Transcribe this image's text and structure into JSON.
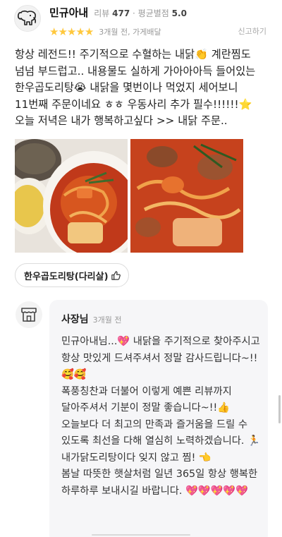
{
  "reviewer": {
    "nickname": "민규아내",
    "review_count_label": "리뷰",
    "review_count": "477",
    "avg_rating_label": "평균별점",
    "avg_rating": "5.0",
    "avatar_icon": "elephant-icon"
  },
  "rating": {
    "stars": 5,
    "star_glyph": "★",
    "star_color": "#ffc83d"
  },
  "meta": "3개월 전, 가게배달",
  "report_label": "신고하기",
  "review": {
    "text": "항상 레전드!! 주기적으로 수혈하는 내닭👏 계란찜도 넘넘 부드럽고.. 내용물도 실하게 가아아아득 들어있는 한우곱도리탕😭 내닭을 몇번이나 먹었지 세어보니 11번째 주문이네요 ㅎㅎ 우동사리 추가 필수!!!!!!⭐ 오늘 저녁은 내가 행복하고싶다 >> 내닭 주문.."
  },
  "photos": [
    {
      "icon": "food-photo-icon"
    },
    {
      "icon": "food-photo-icon"
    }
  ],
  "menu_chip": {
    "label": "한우곱도리탕(다리살)",
    "icon": "thumbs-up-icon"
  },
  "owner_reply": {
    "name": "사장님",
    "date": "3개월 전",
    "icon": "store-icon",
    "text": "민규아내님...💖 내닭을 주기적으로 찾아주시고 항상 맛있게 드셔주셔서 정말 감사드립니다~!!🥰🥰\n폭풍칭찬과 더불어 이렇게 예쁜 리뷰까지 달아주셔서 기분이 정말 좋습니다~!!👍\n오늘보다 더 최고의 만족과 즐거움을 드릴 수 있도록 최선을 다해 열심히 노력하겠습니다. 🏃\n내가닭도리탕이다 잊지 않고 찜! 👈\n봄날 따뜻한 햇살처럼 일년 365일 항상 행복한 하루하루 보내시길 바랍니다. 💖💖💖💖💖"
  },
  "colors": {
    "accent_star": "#ffc83d",
    "reply_bg": "#f6f6f8",
    "muted": "#999999"
  }
}
